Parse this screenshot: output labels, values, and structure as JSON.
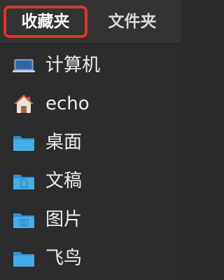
{
  "tabs": [
    {
      "label": "收藏夹",
      "active": true
    },
    {
      "label": "文件夹",
      "active": false
    }
  ],
  "items": [
    {
      "label": "计算机",
      "icon": "laptop-icon"
    },
    {
      "label": "echo",
      "icon": "home-icon"
    },
    {
      "label": "桌面",
      "icon": "folder-icon"
    },
    {
      "label": "文稿",
      "icon": "documents-folder-icon"
    },
    {
      "label": "图片",
      "icon": "pictures-folder-icon"
    },
    {
      "label": "飞鸟",
      "icon": "folder-icon"
    }
  ],
  "colors": {
    "accent_outline": "#e0332f",
    "folder_blue": "#3fa9e6",
    "background": "#2c2c2c"
  }
}
